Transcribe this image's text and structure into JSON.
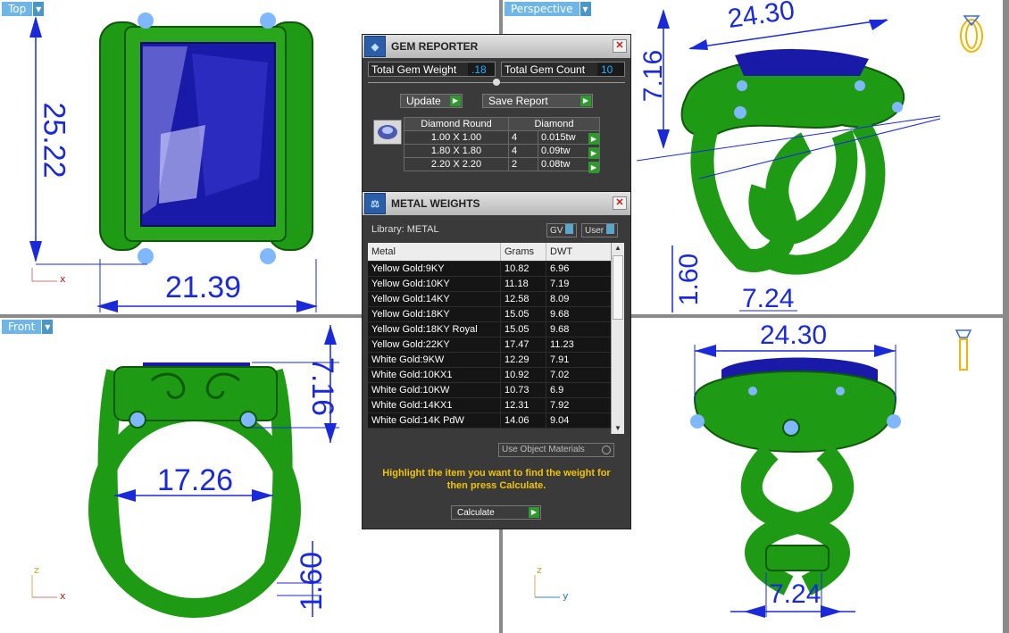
{
  "viewports": {
    "top": {
      "label": "Top",
      "dims": [
        "25.22",
        "21.39"
      ],
      "axis_x": "x"
    },
    "perspective": {
      "label": "Perspective",
      "dims": [
        "24.30",
        "7.16",
        "1.60",
        "7.24"
      ]
    },
    "front": {
      "label": "Front",
      "dims": [
        "7.16",
        "17.26",
        "1.60"
      ],
      "axis_z": "z",
      "axis_x": "x"
    },
    "right": {
      "dims": [
        "24.30",
        "7.24"
      ],
      "axis_z": "z",
      "axis_y": "y"
    }
  },
  "gem_reporter": {
    "title": "GEM REPORTER",
    "total_weight_label": "Total Gem Weight",
    "total_weight_value": ".18",
    "total_count_label": "Total Gem Count",
    "total_count_value": "10",
    "update_label": "Update",
    "save_report_label": "Save Report",
    "table_header": [
      "Diamond Round",
      "Diamond"
    ],
    "rows": [
      {
        "size": "1.00 X 1.00",
        "count": "4",
        "weight": "0.015tw"
      },
      {
        "size": "1.80 X 1.80",
        "count": "4",
        "weight": "0.09tw"
      },
      {
        "size": "2.20 X 2.20",
        "count": "2",
        "weight": "0.08tw"
      }
    ]
  },
  "metal_weights": {
    "title": "METAL WEIGHTS",
    "library": "Library: METAL",
    "gv_label": "GV",
    "user_label": "User",
    "columns": [
      "Metal",
      "Grams",
      "DWT"
    ],
    "rows": [
      {
        "metal": "Yellow Gold:9KY",
        "grams": "10.82",
        "dwt": "6.96"
      },
      {
        "metal": "Yellow Gold:10KY",
        "grams": "11.18",
        "dwt": "7.19"
      },
      {
        "metal": "Yellow Gold:14KY",
        "grams": "12.58",
        "dwt": "8.09"
      },
      {
        "metal": "Yellow Gold:18KY",
        "grams": "15.05",
        "dwt": "9.68"
      },
      {
        "metal": "Yellow Gold:18KY Royal",
        "grams": "15.05",
        "dwt": "9.68"
      },
      {
        "metal": "Yellow Gold:22KY",
        "grams": "17.47",
        "dwt": "11.23"
      },
      {
        "metal": "White Gold:9KW",
        "grams": "12.29",
        "dwt": "7.91"
      },
      {
        "metal": "White Gold:10KX1",
        "grams": "10.92",
        "dwt": "7.02"
      },
      {
        "metal": "White Gold:10KW",
        "grams": "10.73",
        "dwt": "6.9"
      },
      {
        "metal": "White Gold:14KX1",
        "grams": "12.31",
        "dwt": "7.92"
      },
      {
        "metal": "White Gold:14K PdW",
        "grams": "14.06",
        "dwt": "9.04"
      }
    ],
    "use_object_materials": "Use Object Materials",
    "instruction": "Highlight the item you want to find the weight for then press Calculate.",
    "calculate_label": "Calculate"
  },
  "colors": {
    "metal": "#1f9a14",
    "gem": "#1a1aa8",
    "dimension": "#1b2ad8",
    "accent": "#f2c400"
  }
}
